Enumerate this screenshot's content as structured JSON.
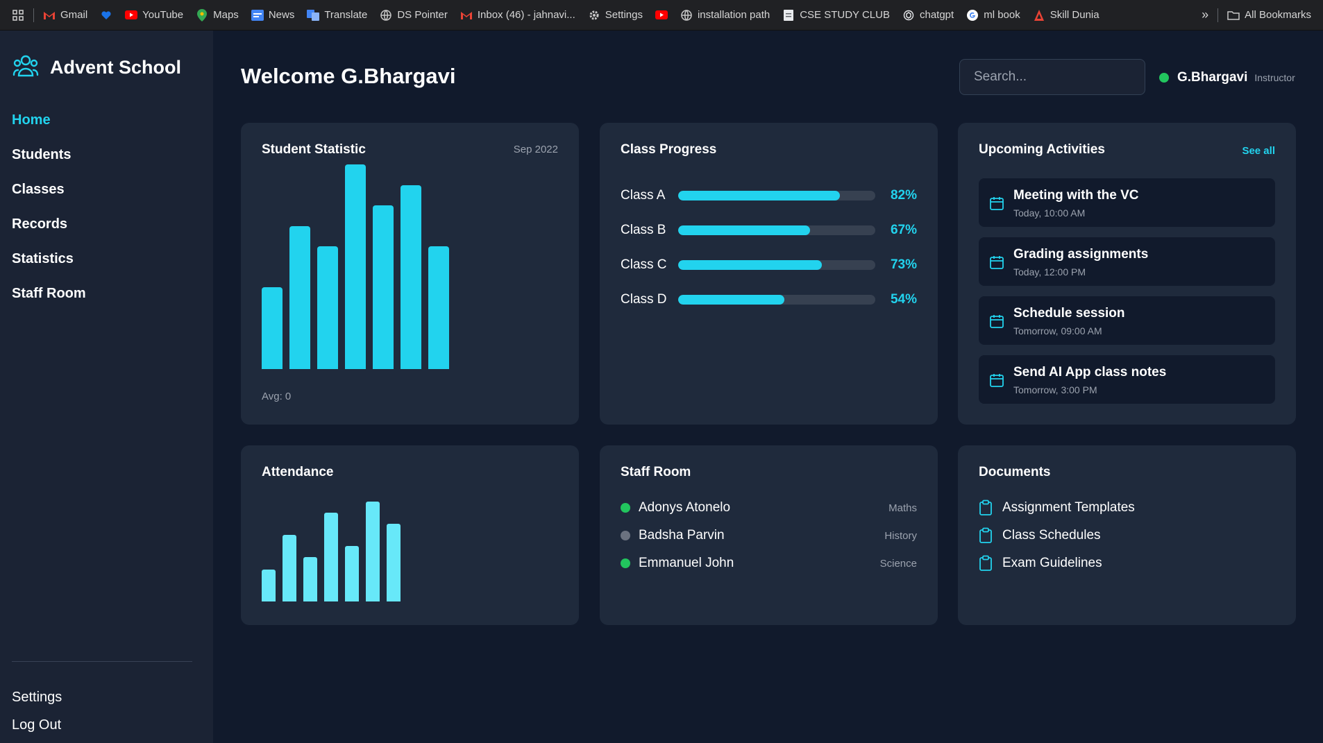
{
  "bookmarks": {
    "items": [
      {
        "label": "Gmail",
        "icon": "gmail-icon"
      },
      {
        "label": "",
        "icon": "heart-icon"
      },
      {
        "label": "YouTube",
        "icon": "youtube-icon"
      },
      {
        "label": "Maps",
        "icon": "maps-icon"
      },
      {
        "label": "News",
        "icon": "news-icon"
      },
      {
        "label": "Translate",
        "icon": "translate-icon"
      },
      {
        "label": "DS Pointer",
        "icon": "globe-icon"
      },
      {
        "label": "Inbox (46) - jahnavi...",
        "icon": "gmail-icon"
      },
      {
        "label": "Settings",
        "icon": "gear-icon"
      },
      {
        "label": "",
        "icon": "youtube-icon"
      },
      {
        "label": "installation path",
        "icon": "globe-icon"
      },
      {
        "label": "CSE STUDY CLUB",
        "icon": "page-icon"
      },
      {
        "label": "chatgpt",
        "icon": "chatgpt-icon"
      },
      {
        "label": "ml book",
        "icon": "google-icon"
      },
      {
        "label": "Skill Dunia",
        "icon": "skill-icon"
      }
    ],
    "more": "»",
    "all_bookmarks": "All Bookmarks"
  },
  "sidebar": {
    "brand": "Advent School",
    "nav": [
      "Home",
      "Students",
      "Classes",
      "Records",
      "Statistics",
      "Staff Room"
    ],
    "active": "Home",
    "bottom": [
      "Settings",
      "Log Out"
    ]
  },
  "header": {
    "welcome": "Welcome G.Bhargavi",
    "search_placeholder": "Search...",
    "user_name": "G.Bhargavi",
    "user_role": "Instructor"
  },
  "student_statistic": {
    "title": "Student Statistic",
    "date": "Sep 2022",
    "avg": "Avg: 0",
    "chart_data": {
      "type": "bar",
      "values": [
        40,
        70,
        60,
        100,
        80,
        90,
        60
      ],
      "ylim": [
        0,
        100
      ]
    }
  },
  "class_progress": {
    "title": "Class Progress",
    "rows": [
      {
        "label": "Class A",
        "value": 82,
        "pct": "82%"
      },
      {
        "label": "Class B",
        "value": 67,
        "pct": "67%"
      },
      {
        "label": "Class C",
        "value": 73,
        "pct": "73%"
      },
      {
        "label": "Class D",
        "value": 54,
        "pct": "54%"
      }
    ]
  },
  "upcoming": {
    "title": "Upcoming Activities",
    "see_all": "See all",
    "items": [
      {
        "title": "Meeting with the VC",
        "time": "Today, 10:00 AM"
      },
      {
        "title": "Grading assignments",
        "time": "Today, 12:00 PM"
      },
      {
        "title": "Schedule session",
        "time": "Tomorrow, 09:00 AM"
      },
      {
        "title": "Send AI App class notes",
        "time": "Tomorrow, 3:00 PM"
      }
    ]
  },
  "attendance": {
    "title": "Attendance",
    "chart_data": {
      "type": "bar",
      "values": [
        32,
        66,
        44,
        88,
        55,
        99,
        77
      ],
      "ylim": [
        0,
        100
      ]
    }
  },
  "staff_room": {
    "title": "Staff Room",
    "members": [
      {
        "name": "Adonys Atonelo",
        "subject": "Maths",
        "status_color": "#22c55e"
      },
      {
        "name": "Badsha Parvin",
        "subject": "History",
        "status_color": "#6b7280"
      },
      {
        "name": "Emmanuel John",
        "subject": "Science",
        "status_color": "#22c55e"
      }
    ]
  },
  "documents": {
    "title": "Documents",
    "items": [
      "Assignment Templates",
      "Class Schedules",
      "Exam Guidelines"
    ]
  },
  "colors": {
    "accent": "#22d3ee",
    "background": "#111a2c",
    "card": "#1f2a3c",
    "online": "#22c55e",
    "offline": "#6b7280"
  }
}
